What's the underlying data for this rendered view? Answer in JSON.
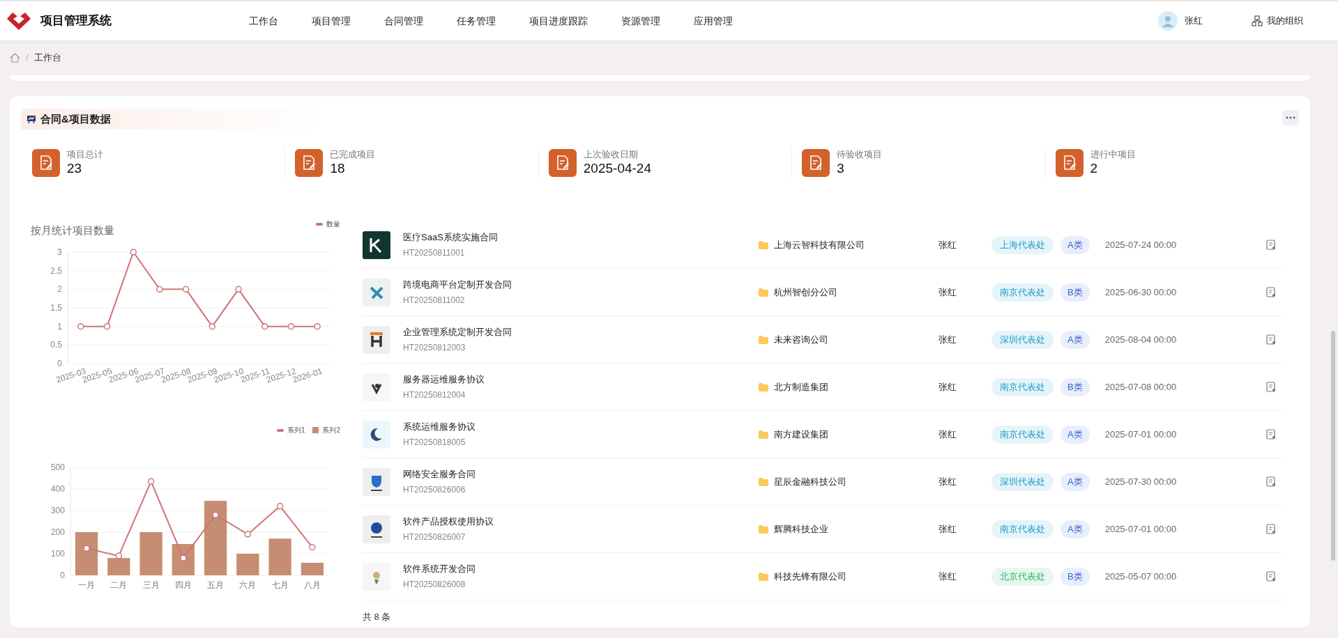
{
  "app": {
    "title": "项目管理系统"
  },
  "nav": [
    {
      "label": "工作台"
    },
    {
      "label": "项目管理"
    },
    {
      "label": "合同管理"
    },
    {
      "label": "任务管理"
    },
    {
      "label": "项目进度跟踪"
    },
    {
      "label": "资源管理"
    },
    {
      "label": "应用管理"
    }
  ],
  "user": {
    "name": "张红"
  },
  "org_link": "我的组织",
  "breadcrumb": [
    "工作台"
  ],
  "breadcrumb_separator": "/",
  "panel": {
    "title": "合同&项目数据",
    "stats": [
      {
        "label": "项目总计",
        "value": "23"
      },
      {
        "label": "已完成项目",
        "value": "18"
      },
      {
        "label": "上次验收日期",
        "value": "2025-04-24"
      },
      {
        "label": "待验收项目",
        "value": "3"
      },
      {
        "label": "进行中项目",
        "value": "2"
      }
    ],
    "line_chart": {
      "chart_data": {
        "type": "line",
        "title": "按月统计项目数量",
        "categories": [
          "2025-03",
          "2025-05",
          "2025-06",
          "2025-07",
          "2025-08",
          "2025-09",
          "2025-10",
          "2025-11",
          "2025-12",
          "2026-01"
        ],
        "series": [
          {
            "name": "数量",
            "color": "#d07478",
            "marker": "circle",
            "values": [
              1,
              1,
              3,
              2,
              2,
              1,
              2,
              1,
              1,
              1
            ]
          }
        ],
        "ylim": [
          0,
          3
        ],
        "yticks": [
          0,
          0.5,
          1,
          1.5,
          2,
          2.5,
          3
        ],
        "grid": true,
        "legend": "top-right"
      }
    },
    "combo_chart": {
      "chart_data": {
        "type": "bar",
        "categories": [
          "一月",
          "二月",
          "三月",
          "四月",
          "五月",
          "六月",
          "七月",
          "八月"
        ],
        "series": [
          {
            "name": "系列1",
            "type": "line",
            "color": "#d07478",
            "marker": "circle",
            "values": [
              125,
              90,
              435,
              80,
              280,
              190,
              320,
              130
            ]
          },
          {
            "name": "系列2",
            "color": "#c68d72",
            "values": [
              200,
              80,
              200,
              145,
              345,
              100,
              170,
              58
            ]
          }
        ],
        "ylim": [
          0,
          500
        ],
        "yticks": [
          0,
          100,
          200,
          300,
          400,
          500
        ],
        "grid": true,
        "stacked": false,
        "legend": "top-right"
      }
    },
    "contracts": {
      "rows": [
        {
          "name": "医疗SaaS系统实施合同",
          "code": "HT20250811001",
          "company": "上海云智科技有限公司",
          "owner": "张红",
          "region": {
            "label": "上海代表处",
            "color": "#1a9cc4"
          },
          "category": "A类",
          "date": "2025-07-24 00:00"
        },
        {
          "name": "跨境电商平台定制开发合同",
          "code": "HT20250811002",
          "company": "杭州智创分公司",
          "owner": "张红",
          "region": {
            "label": "南京代表处",
            "color": "#1a9cc4"
          },
          "category": "B类",
          "date": "2025-06-30 00:00"
        },
        {
          "name": "企业管理系统定制开发合同",
          "code": "HT20250812003",
          "company": "未来咨询公司",
          "owner": "张红",
          "region": {
            "label": "深圳代表处",
            "color": "#1a9cc4"
          },
          "category": "A类",
          "date": "2025-08-04 00:00"
        },
        {
          "name": "服务器运维服务协议",
          "code": "HT20250812004",
          "company": "北方制造集团",
          "owner": "张红",
          "region": {
            "label": "南京代表处",
            "color": "#1a9cc4"
          },
          "category": "B类",
          "date": "2025-07-08 00:00"
        },
        {
          "name": "系统运维服务协议",
          "code": "HT20250818005",
          "company": "南方建设集团",
          "owner": "张红",
          "region": {
            "label": "南京代表处",
            "color": "#1a9cc4"
          },
          "category": "A类",
          "date": "2025-07-01 00:00"
        },
        {
          "name": "网络安全服务合同",
          "code": "HT20250826006",
          "company": "星辰金融科技公司",
          "owner": "张红",
          "region": {
            "label": "深圳代表处",
            "color": "#1a9cc4"
          },
          "category": "A类",
          "date": "2025-07-30 00:00"
        },
        {
          "name": "软件产品授权使用协议",
          "code": "HT20250826007",
          "company": "辉腾科技企业",
          "owner": "张红",
          "region": {
            "label": "南京代表处",
            "color": "#1a9cc4"
          },
          "category": "A类",
          "date": "2025-07-01 00:00"
        },
        {
          "name": "软件系统开发合同",
          "code": "HT20250826008",
          "company": "科技先锋有限公司",
          "owner": "张红",
          "region": {
            "label": "北京代表处",
            "color": "#2db36f"
          },
          "category": "B类",
          "date": "2025-05-07 00:00"
        }
      ],
      "total": "共 8 条"
    }
  }
}
